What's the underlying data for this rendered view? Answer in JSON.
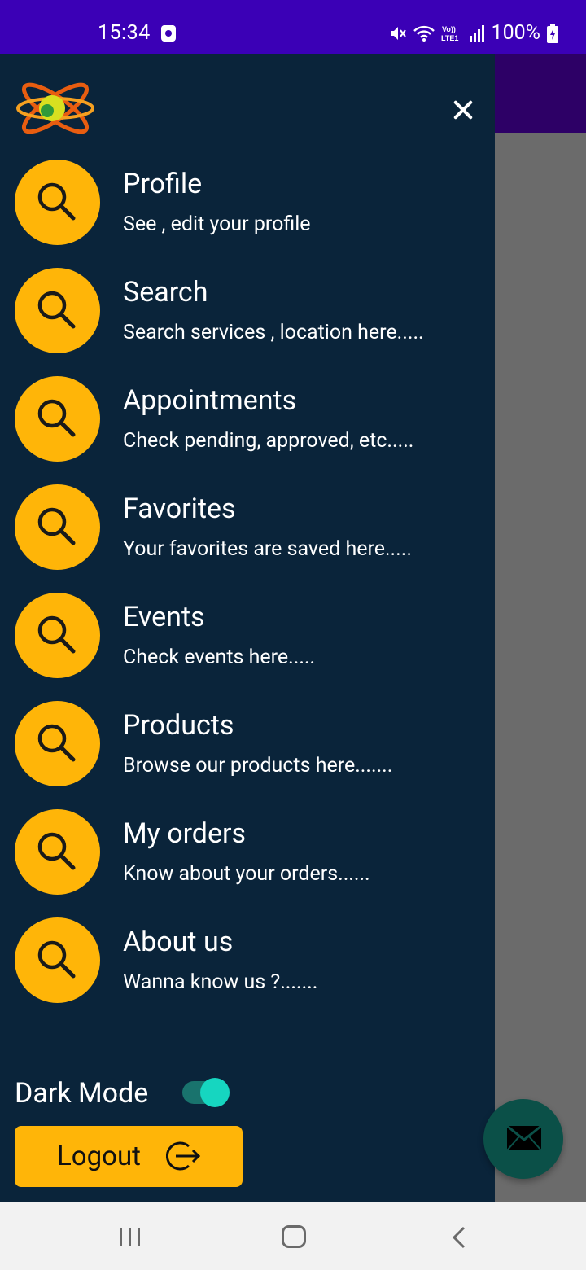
{
  "status_bar": {
    "time": "15:34",
    "battery": "100%",
    "icons": [
      "mute-icon",
      "wifi-icon",
      "volte-lte-icon",
      "signal-icon",
      "battery-charging-icon"
    ]
  },
  "drawer": {
    "menu": [
      {
        "title": "Profile",
        "subtitle": "See , edit your profile",
        "icon": "search-icon"
      },
      {
        "title": "Search",
        "subtitle": "Search services , location here.....",
        "icon": "search-icon"
      },
      {
        "title": "Appointments",
        "subtitle": "Check pending, approved, etc.....",
        "icon": "search-icon"
      },
      {
        "title": "Favorites",
        "subtitle": "Your favorites are saved here.....",
        "icon": "search-icon"
      },
      {
        "title": "Events",
        "subtitle": "Check events here.....",
        "icon": "search-icon"
      },
      {
        "title": "Products",
        "subtitle": "Browse our products here.......",
        "icon": "search-icon"
      },
      {
        "title": "My orders",
        "subtitle": "Know about your orders......",
        "icon": "search-icon"
      },
      {
        "title": "About us",
        "subtitle": "Wanna know us ?.......",
        "icon": "search-icon"
      }
    ],
    "dark_mode": {
      "label": "Dark Mode",
      "enabled": true
    },
    "logout": {
      "label": "Logout",
      "icon": "logout-icon"
    }
  },
  "colors": {
    "status_bar": "#3b00b6",
    "drawer_bg": "#0a243a",
    "accent_yellow": "#ffb508",
    "toggle_on": "#16d6c0",
    "fab": "#0b5048"
  }
}
